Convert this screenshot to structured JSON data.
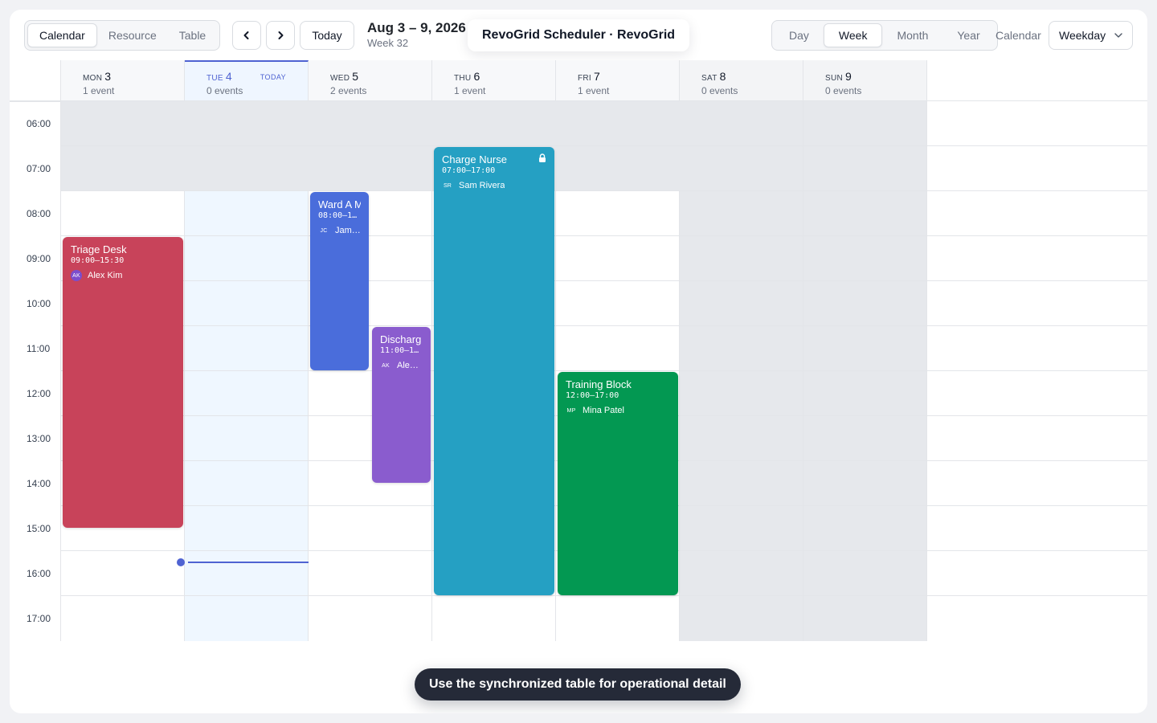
{
  "app_title": "RevoGrid Scheduler · RevoGrid",
  "view_switcher": [
    {
      "label": "Calendar",
      "active": true
    },
    {
      "label": "Resource",
      "active": false
    },
    {
      "label": "Table",
      "active": false
    }
  ],
  "nav": {
    "prev_icon": "chevron-left-icon",
    "next_icon": "chevron-right-icon",
    "today_label": "Today"
  },
  "range": {
    "title": "Aug 3 – 9, 2026",
    "subtitle": "Week 32"
  },
  "period_switcher": [
    {
      "label": "Day",
      "active": false
    },
    {
      "label": "Week",
      "active": true
    },
    {
      "label": "Month",
      "active": false
    },
    {
      "label": "Year",
      "active": false
    }
  ],
  "calendar_select": {
    "label": "Calendar",
    "value": "Weekday"
  },
  "days": [
    {
      "name": "MON",
      "num": "3",
      "count": "1 event",
      "today": false,
      "weekend": false
    },
    {
      "name": "TUE",
      "num": "4",
      "count": "0 events",
      "today": true,
      "weekend": false,
      "tag": "TODAY"
    },
    {
      "name": "WED",
      "num": "5",
      "count": "2 events",
      "today": false,
      "weekend": false
    },
    {
      "name": "THU",
      "num": "6",
      "count": "1 event",
      "today": false,
      "weekend": false
    },
    {
      "name": "FRI",
      "num": "7",
      "count": "1 event",
      "today": false,
      "weekend": false
    },
    {
      "name": "SAT",
      "num": "8",
      "count": "0 events",
      "today": false,
      "weekend": true
    },
    {
      "name": "SUN",
      "num": "9",
      "count": "0 events",
      "today": false,
      "weekend": true
    }
  ],
  "hours": [
    "06:00",
    "07:00",
    "08:00",
    "09:00",
    "10:00",
    "11:00",
    "12:00",
    "13:00",
    "14:00",
    "15:00",
    "16:00",
    "17:00"
  ],
  "work_hours_start": "08:00",
  "now_time": "16:15",
  "events": [
    {
      "title": "Triage Desk",
      "time": "09:00–15:30",
      "initials": "AK",
      "person": "Alex Kim",
      "day": 0,
      "start": 9,
      "end": 15.5,
      "color": "#c8435a",
      "avatar_filled": true,
      "locked": false,
      "lane": 0,
      "lanes": 1
    },
    {
      "title": "Ward A M",
      "time": "08:00–1…",
      "initials": "JC",
      "person": "Jami…",
      "day": 2,
      "start": 8,
      "end": 12,
      "color": "#4a6ddb",
      "avatar_filled": false,
      "locked": false,
      "lane": 0,
      "lanes": 2
    },
    {
      "title": "Discharg",
      "time": "11:00–1…",
      "initials": "AK",
      "person": "Alex…",
      "day": 2,
      "start": 11,
      "end": 14.5,
      "color": "#8a5cce",
      "avatar_filled": false,
      "locked": false,
      "lane": 1,
      "lanes": 2
    },
    {
      "title": "Charge Nurse",
      "time": "07:00–17:00",
      "initials": "SR",
      "person": "Sam Rivera",
      "day": 3,
      "start": 7,
      "end": 17,
      "color": "#25a0c3",
      "avatar_filled": false,
      "locked": true,
      "lane": 0,
      "lanes": 1
    },
    {
      "title": "Training Block",
      "time": "12:00–17:00",
      "initials": "MP",
      "person": "Mina Patel",
      "day": 4,
      "start": 12,
      "end": 17,
      "color": "#039852",
      "avatar_filled": false,
      "locked": false,
      "lane": 0,
      "lanes": 1
    }
  ],
  "footer_hint": "Use the synchronized table for operational detail"
}
